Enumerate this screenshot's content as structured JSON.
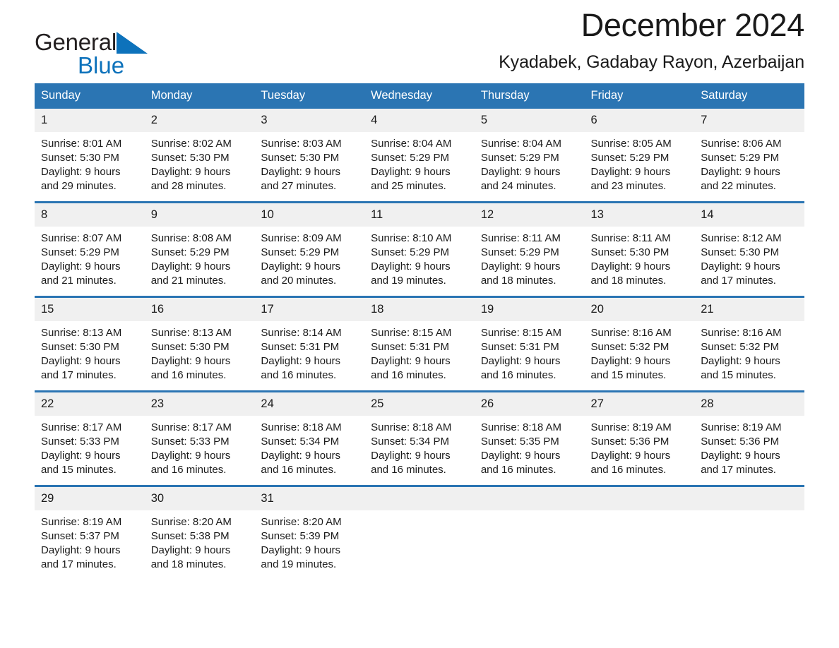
{
  "brand": {
    "name_part1": "General",
    "name_part2": "Blue",
    "triangle_color": "#0d72bb",
    "text_color": "#231f20"
  },
  "header": {
    "title": "December 2024",
    "subtitle": "Kyadabek, Gadabay Rayon, Azerbaijan"
  },
  "theme": {
    "header_blue": "#2b75b3",
    "daynum_gray": "#f0f0f0",
    "text": "#1a1a1a"
  },
  "weekdays": [
    "Sunday",
    "Monday",
    "Tuesday",
    "Wednesday",
    "Thursday",
    "Friday",
    "Saturday"
  ],
  "weeks": [
    [
      {
        "day": "1",
        "sunrise": "Sunrise: 8:01 AM",
        "sunset": "Sunset: 5:30 PM",
        "daylight1": "Daylight: 9 hours",
        "daylight2": "and 29 minutes."
      },
      {
        "day": "2",
        "sunrise": "Sunrise: 8:02 AM",
        "sunset": "Sunset: 5:30 PM",
        "daylight1": "Daylight: 9 hours",
        "daylight2": "and 28 minutes."
      },
      {
        "day": "3",
        "sunrise": "Sunrise: 8:03 AM",
        "sunset": "Sunset: 5:30 PM",
        "daylight1": "Daylight: 9 hours",
        "daylight2": "and 27 minutes."
      },
      {
        "day": "4",
        "sunrise": "Sunrise: 8:04 AM",
        "sunset": "Sunset: 5:29 PM",
        "daylight1": "Daylight: 9 hours",
        "daylight2": "and 25 minutes."
      },
      {
        "day": "5",
        "sunrise": "Sunrise: 8:04 AM",
        "sunset": "Sunset: 5:29 PM",
        "daylight1": "Daylight: 9 hours",
        "daylight2": "and 24 minutes."
      },
      {
        "day": "6",
        "sunrise": "Sunrise: 8:05 AM",
        "sunset": "Sunset: 5:29 PM",
        "daylight1": "Daylight: 9 hours",
        "daylight2": "and 23 minutes."
      },
      {
        "day": "7",
        "sunrise": "Sunrise: 8:06 AM",
        "sunset": "Sunset: 5:29 PM",
        "daylight1": "Daylight: 9 hours",
        "daylight2": "and 22 minutes."
      }
    ],
    [
      {
        "day": "8",
        "sunrise": "Sunrise: 8:07 AM",
        "sunset": "Sunset: 5:29 PM",
        "daylight1": "Daylight: 9 hours",
        "daylight2": "and 21 minutes."
      },
      {
        "day": "9",
        "sunrise": "Sunrise: 8:08 AM",
        "sunset": "Sunset: 5:29 PM",
        "daylight1": "Daylight: 9 hours",
        "daylight2": "and 21 minutes."
      },
      {
        "day": "10",
        "sunrise": "Sunrise: 8:09 AM",
        "sunset": "Sunset: 5:29 PM",
        "daylight1": "Daylight: 9 hours",
        "daylight2": "and 20 minutes."
      },
      {
        "day": "11",
        "sunrise": "Sunrise: 8:10 AM",
        "sunset": "Sunset: 5:29 PM",
        "daylight1": "Daylight: 9 hours",
        "daylight2": "and 19 minutes."
      },
      {
        "day": "12",
        "sunrise": "Sunrise: 8:11 AM",
        "sunset": "Sunset: 5:29 PM",
        "daylight1": "Daylight: 9 hours",
        "daylight2": "and 18 minutes."
      },
      {
        "day": "13",
        "sunrise": "Sunrise: 8:11 AM",
        "sunset": "Sunset: 5:30 PM",
        "daylight1": "Daylight: 9 hours",
        "daylight2": "and 18 minutes."
      },
      {
        "day": "14",
        "sunrise": "Sunrise: 8:12 AM",
        "sunset": "Sunset: 5:30 PM",
        "daylight1": "Daylight: 9 hours",
        "daylight2": "and 17 minutes."
      }
    ],
    [
      {
        "day": "15",
        "sunrise": "Sunrise: 8:13 AM",
        "sunset": "Sunset: 5:30 PM",
        "daylight1": "Daylight: 9 hours",
        "daylight2": "and 17 minutes."
      },
      {
        "day": "16",
        "sunrise": "Sunrise: 8:13 AM",
        "sunset": "Sunset: 5:30 PM",
        "daylight1": "Daylight: 9 hours",
        "daylight2": "and 16 minutes."
      },
      {
        "day": "17",
        "sunrise": "Sunrise: 8:14 AM",
        "sunset": "Sunset: 5:31 PM",
        "daylight1": "Daylight: 9 hours",
        "daylight2": "and 16 minutes."
      },
      {
        "day": "18",
        "sunrise": "Sunrise: 8:15 AM",
        "sunset": "Sunset: 5:31 PM",
        "daylight1": "Daylight: 9 hours",
        "daylight2": "and 16 minutes."
      },
      {
        "day": "19",
        "sunrise": "Sunrise: 8:15 AM",
        "sunset": "Sunset: 5:31 PM",
        "daylight1": "Daylight: 9 hours",
        "daylight2": "and 16 minutes."
      },
      {
        "day": "20",
        "sunrise": "Sunrise: 8:16 AM",
        "sunset": "Sunset: 5:32 PM",
        "daylight1": "Daylight: 9 hours",
        "daylight2": "and 15 minutes."
      },
      {
        "day": "21",
        "sunrise": "Sunrise: 8:16 AM",
        "sunset": "Sunset: 5:32 PM",
        "daylight1": "Daylight: 9 hours",
        "daylight2": "and 15 minutes."
      }
    ],
    [
      {
        "day": "22",
        "sunrise": "Sunrise: 8:17 AM",
        "sunset": "Sunset: 5:33 PM",
        "daylight1": "Daylight: 9 hours",
        "daylight2": "and 15 minutes."
      },
      {
        "day": "23",
        "sunrise": "Sunrise: 8:17 AM",
        "sunset": "Sunset: 5:33 PM",
        "daylight1": "Daylight: 9 hours",
        "daylight2": "and 16 minutes."
      },
      {
        "day": "24",
        "sunrise": "Sunrise: 8:18 AM",
        "sunset": "Sunset: 5:34 PM",
        "daylight1": "Daylight: 9 hours",
        "daylight2": "and 16 minutes."
      },
      {
        "day": "25",
        "sunrise": "Sunrise: 8:18 AM",
        "sunset": "Sunset: 5:34 PM",
        "daylight1": "Daylight: 9 hours",
        "daylight2": "and 16 minutes."
      },
      {
        "day": "26",
        "sunrise": "Sunrise: 8:18 AM",
        "sunset": "Sunset: 5:35 PM",
        "daylight1": "Daylight: 9 hours",
        "daylight2": "and 16 minutes."
      },
      {
        "day": "27",
        "sunrise": "Sunrise: 8:19 AM",
        "sunset": "Sunset: 5:36 PM",
        "daylight1": "Daylight: 9 hours",
        "daylight2": "and 16 minutes."
      },
      {
        "day": "28",
        "sunrise": "Sunrise: 8:19 AM",
        "sunset": "Sunset: 5:36 PM",
        "daylight1": "Daylight: 9 hours",
        "daylight2": "and 17 minutes."
      }
    ],
    [
      {
        "day": "29",
        "sunrise": "Sunrise: 8:19 AM",
        "sunset": "Sunset: 5:37 PM",
        "daylight1": "Daylight: 9 hours",
        "daylight2": "and 17 minutes."
      },
      {
        "day": "30",
        "sunrise": "Sunrise: 8:20 AM",
        "sunset": "Sunset: 5:38 PM",
        "daylight1": "Daylight: 9 hours",
        "daylight2": "and 18 minutes."
      },
      {
        "day": "31",
        "sunrise": "Sunrise: 8:20 AM",
        "sunset": "Sunset: 5:39 PM",
        "daylight1": "Daylight: 9 hours",
        "daylight2": "and 19 minutes."
      },
      {
        "day": "",
        "sunrise": "",
        "sunset": "",
        "daylight1": "",
        "daylight2": ""
      },
      {
        "day": "",
        "sunrise": "",
        "sunset": "",
        "daylight1": "",
        "daylight2": ""
      },
      {
        "day": "",
        "sunrise": "",
        "sunset": "",
        "daylight1": "",
        "daylight2": ""
      },
      {
        "day": "",
        "sunrise": "",
        "sunset": "",
        "daylight1": "",
        "daylight2": ""
      }
    ]
  ]
}
